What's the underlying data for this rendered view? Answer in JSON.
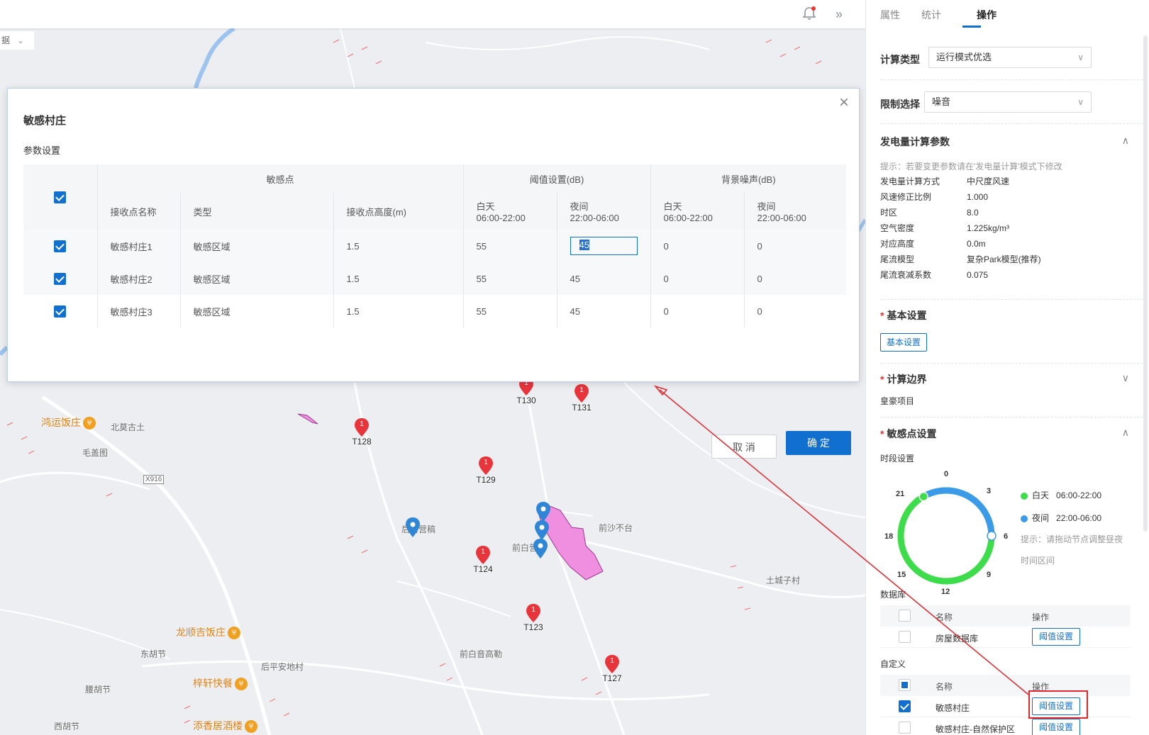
{
  "map": {
    "data_tag": "据",
    "places": [
      "北莫古土",
      "毛盖图",
      "前沙不台",
      "后白营稿",
      "前白营稿",
      "土城子村",
      "前白音高勒",
      "东胡节",
      "后平安地村",
      "腰胡节",
      "西胡节",
      "X916"
    ],
    "pois": [
      "鸿运饭庄",
      "龙顺吉饭庄",
      "梓轩快餐",
      "添香居酒楼"
    ],
    "markers": [
      "T130",
      "T131",
      "T128",
      "T129",
      "T124",
      "T123",
      "T127"
    ],
    "marker_count": "1",
    "colors": {
      "red_marker": "#e8353b",
      "blue_marker": "#2f86d6",
      "polygon": "#f08ee0"
    }
  },
  "topbar": {
    "bell_icon": "bell-icon",
    "expand_icon": "double-chevron-right-icon"
  },
  "modal": {
    "title": "敏感村庄",
    "subtitle": "参数设置",
    "close": "×",
    "headers": {
      "group_sensitive": "敏感点",
      "group_threshold": "阈值设置(dB)",
      "group_background": "背景噪声(dB)",
      "name": "接收点名称",
      "type": "类型",
      "height": "接收点高度(m)",
      "day": "白天",
      "day_range": "06:00-22:00",
      "night": "夜间",
      "night_range": "22:00-06:00",
      "bg_day": "白天",
      "bg_day_range": "06:00-22:00",
      "bg_night": "夜间",
      "bg_night_range": "22:00-06:00"
    },
    "rows": [
      {
        "name": "敏感村庄1",
        "type": "敏感区域",
        "height": "1.5",
        "day": "55",
        "night": "45",
        "bg_day": "0",
        "bg_night": "0"
      },
      {
        "name": "敏感村庄2",
        "type": "敏感区域",
        "height": "1.5",
        "day": "55",
        "night": "45",
        "bg_day": "0",
        "bg_night": "0"
      },
      {
        "name": "敏感村庄3",
        "type": "敏感区域",
        "height": "1.5",
        "day": "55",
        "night": "45",
        "bg_day": "0",
        "bg_night": "0"
      }
    ],
    "cancel": "取 消",
    "ok": "确 定"
  },
  "panel": {
    "tabs": [
      "属性",
      "统计",
      "操作"
    ],
    "calc_type_label": "计算类型",
    "calc_type_value": "运行模式优选",
    "limit_label": "限制选择",
    "limit_value": "噪音",
    "power_title": "发电量计算参数",
    "power_hint": "提示：若要变更参数请在'发电量计算'模式下修改",
    "params": [
      {
        "k": "发电量计算方式",
        "v": "中尺度风速"
      },
      {
        "k": "风速修正比例",
        "v": "1.000"
      },
      {
        "k": "时区",
        "v": "8.0"
      },
      {
        "k": "空气密度",
        "v": "1.225kg/m³"
      },
      {
        "k": "对应高度",
        "v": "0.0m"
      },
      {
        "k": "尾流模型",
        "v": "复杂Park模型(推荐)"
      },
      {
        "k": "尾流衰减系数",
        "v": "0.075"
      }
    ],
    "basic_title": "基本设置",
    "basic_btn": "基本设置",
    "boundary_title": "计算边界",
    "boundary_value": "皇豪项目",
    "sens_title": "敏感点设置",
    "period_label": "时段设置",
    "clock": [
      "0",
      "3",
      "6",
      "9",
      "12",
      "15",
      "18",
      "21"
    ],
    "legend_day": "白天",
    "legend_day_range": "06:00-22:00",
    "legend_night": "夜间",
    "legend_night_range": "22:00-06:00",
    "clock_hint": "提示：请拖动节点调整昼夜",
    "clock_hint2": "时间区间",
    "db_label": "数据库",
    "col_name": "名称",
    "col_op": "操作",
    "db_rows": [
      {
        "name": "房屋数据库",
        "btn": "阈值设置"
      }
    ],
    "custom_label": "自定义",
    "custom_rows": [
      {
        "name": "敏感村庄",
        "btn": "阈值设置"
      },
      {
        "name": "敏感村庄-自然保护区",
        "btn": "阈值设置"
      }
    ],
    "colors": {
      "accent": "#1170cf",
      "day": "#3ddc4b",
      "night": "#3c9be8",
      "highlight": "#e0292f"
    }
  }
}
